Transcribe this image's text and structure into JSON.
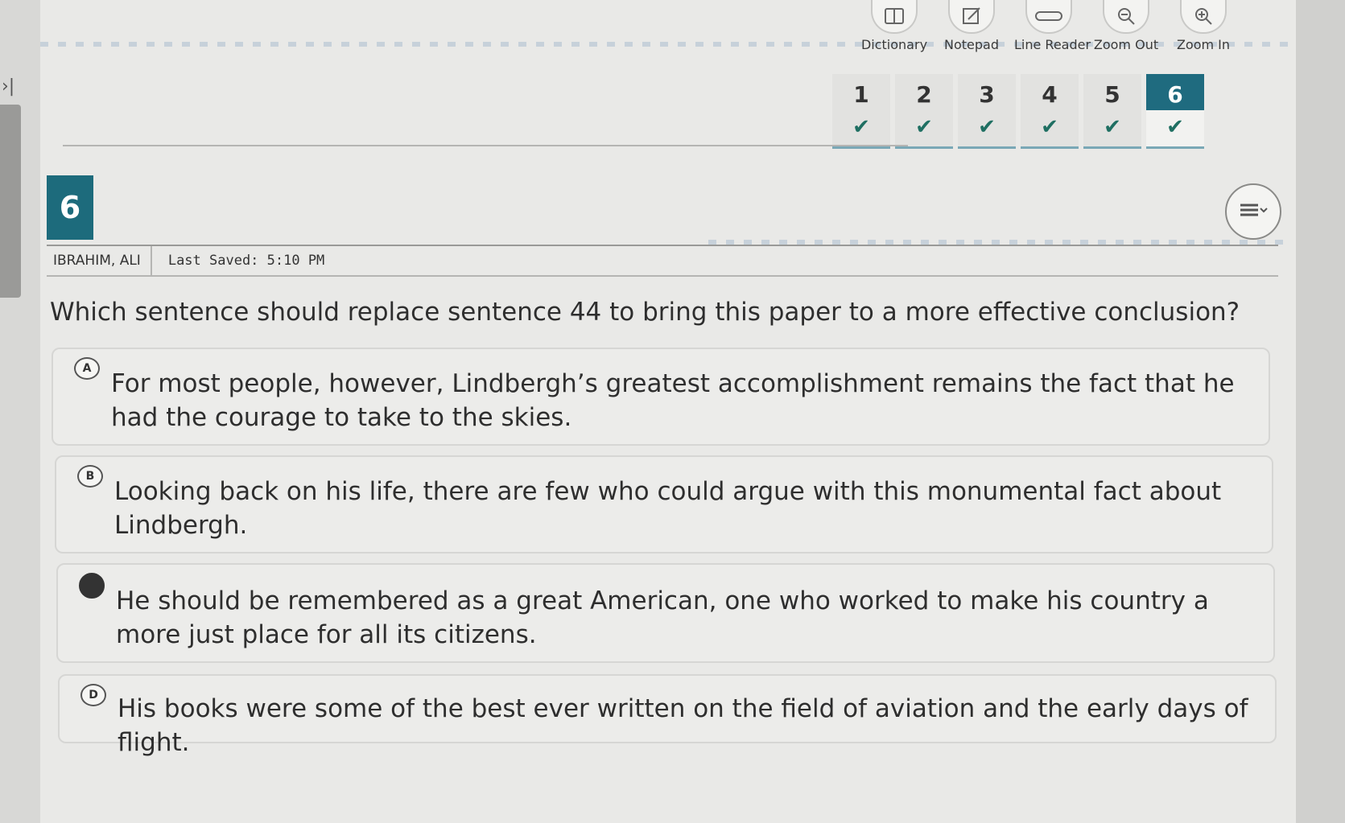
{
  "toolbar": {
    "dictionary": "Dictionary",
    "notepad": "Notepad",
    "line_reader": "Line Reader",
    "zoom_out": "Zoom Out",
    "zoom_in": "Zoom In"
  },
  "question_nav": [
    {
      "num": "1",
      "check": "✔"
    },
    {
      "num": "2",
      "check": "✔"
    },
    {
      "num": "3",
      "check": "✔"
    },
    {
      "num": "4",
      "check": "✔"
    },
    {
      "num": "5",
      "check": "✔"
    },
    {
      "num": "6",
      "check": "✔"
    }
  ],
  "current_question": "6",
  "student": {
    "name": "IBRAHIM, ALI",
    "last_saved": "Last Saved: 5:10 PM"
  },
  "question": "Which sentence should replace sentence 44 to bring this paper to a more effective conclusion?",
  "options": [
    {
      "letter": "A",
      "text": "For most people, however, Lindbergh’s greatest accomplishment remains the fact that he had the courage to take to the skies."
    },
    {
      "letter": "B",
      "text": "Looking back on his life, there are few who could argue with this monumental fact about Lindbergh."
    },
    {
      "letter": "",
      "text": "He should be remembered as a great American, one who worked to make his country a more just place for all its citizens."
    },
    {
      "letter": "D",
      "text": "His books were some of the best ever written on the field of aviation and the early days of flight."
    }
  ],
  "colors": {
    "accent": "#1d6b7c",
    "check": "#1f6f62",
    "selected_bubble": "#333333"
  }
}
